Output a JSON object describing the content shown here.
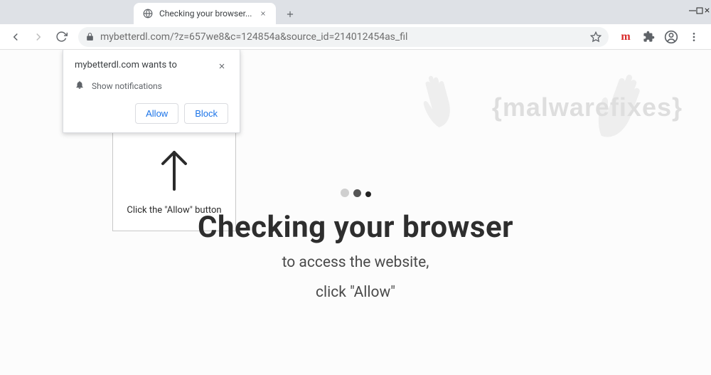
{
  "window": {
    "tab_title": "Checking your browser...",
    "url": "mybetterdl.com/?z=657we8&c=124854a&source_id=214012454as_fil"
  },
  "permission_popup": {
    "prompt": "mybetterdl.com wants to",
    "permission_label": "Show notifications",
    "allow_label": "Allow",
    "block_label": "Block"
  },
  "instruction": {
    "text": "Click the \"Allow\" button"
  },
  "page": {
    "heading": "Checking your browser",
    "subline1": "to access the website,",
    "subline2": "click \"Allow\""
  },
  "watermark": {
    "text": "{malwarefixes}"
  }
}
